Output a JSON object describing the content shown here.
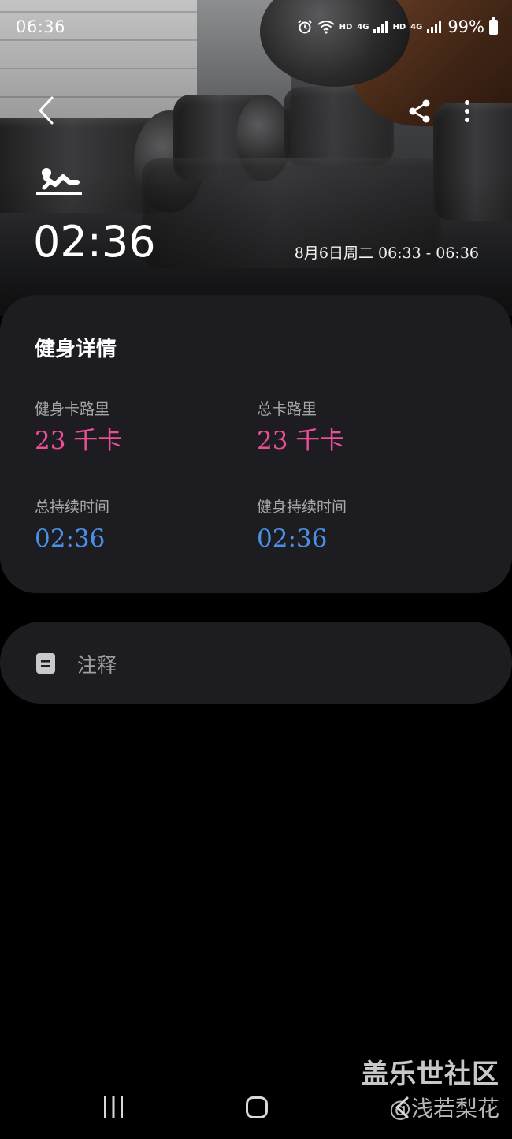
{
  "status_bar": {
    "time": "06:36",
    "hd_1": "HD",
    "network_1": "4G",
    "hd_2": "HD",
    "network_2": "4G",
    "battery": "99%"
  },
  "workout": {
    "icon": "situp-icon",
    "duration": "02:36",
    "session_time": "8月6日周二 06:33 - 06:36"
  },
  "details": {
    "title": "健身详情",
    "stats": [
      {
        "label": "健身卡路里",
        "value": "23 千卡"
      },
      {
        "label": "总卡路里",
        "value": "23 千卡"
      },
      {
        "label": "总持续时间",
        "value": "02:36"
      },
      {
        "label": "健身持续时间",
        "value": "02:36"
      }
    ],
    "colors": {
      "calories": "#ea4f96",
      "duration": "#4a90e6"
    }
  },
  "notes": {
    "label": "注释"
  },
  "watermark": {
    "title": "盖乐世社区",
    "author": "@浅若梨花"
  }
}
